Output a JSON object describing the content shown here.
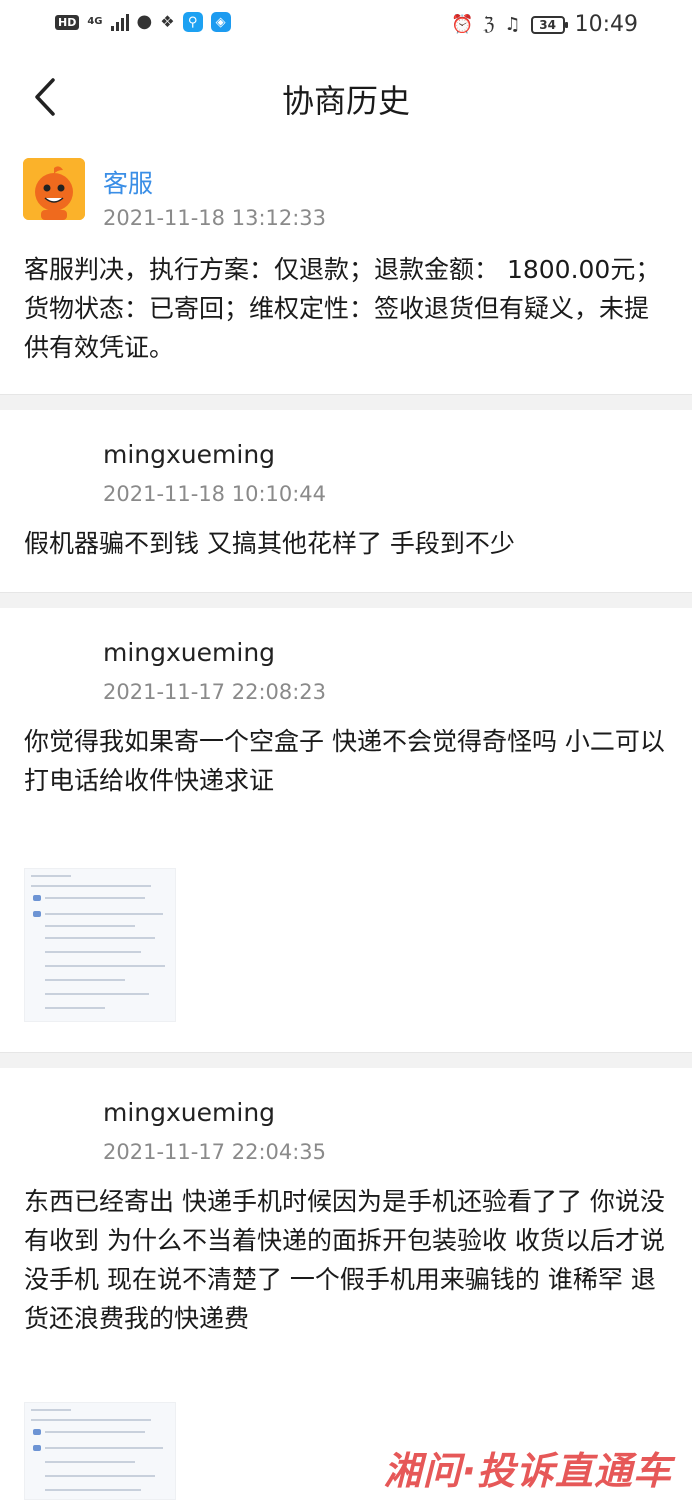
{
  "status_bar": {
    "hd": "HD",
    "network": "4G",
    "battery": "34",
    "time": "10:49"
  },
  "header": {
    "title": "协商历史",
    "back_icon": "chevron-left-icon"
  },
  "records": [
    {
      "sender": "客服",
      "time": "2021-11-18 13:12:33",
      "message": "客服判决，执行方案：仅退款；退款金额： 1800.00元；货物状态：已寄回；维权定性：签收退货但有疑义，未提供有效凭证。"
    },
    {
      "sender": "mingxueming",
      "time": "2021-11-18 10:10:44",
      "message": "假机器骗不到钱  又搞其他花样了  手段到不少"
    },
    {
      "sender": "mingxueming",
      "time": "2021-11-17 22:08:23",
      "message": "你觉得我如果寄一个空盒子  快递不会觉得奇怪吗  小二可以打电话给收件快递求证"
    },
    {
      "sender": "mingxueming",
      "time": "2021-11-17 22:04:35",
      "message": "东西已经寄出  快递手机时候因为是手机还验看了了  你说没有收到  为什么不当着快递的面拆开包装验收  收货以后才说没手机  现在说不清楚了  一个假手机用来骗钱的  谁稀罕  退货还浪费我的快递费"
    }
  ],
  "watermark": "湘问·投诉直通车",
  "colors": {
    "cs_name": "#3a8ee6",
    "divider": "#f2f2f2",
    "timestamp": "#8a8a8a",
    "watermark": "#e23b3b"
  }
}
